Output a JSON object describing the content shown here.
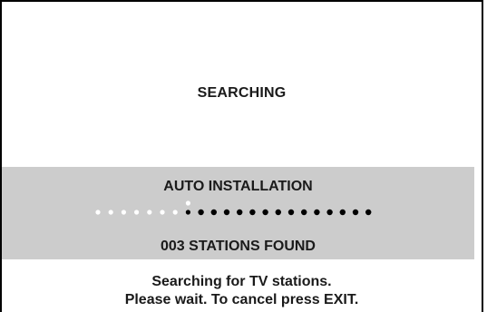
{
  "screen": {
    "status_title": "SEARCHING",
    "panel": {
      "title": "AUTO INSTALLATION",
      "stations_found": "003 STATIONS FOUND",
      "progress": {
        "total_dots": 22,
        "completed_dots": 8,
        "fraction": 0.36,
        "completed_color": "#ffffff",
        "remaining_color": "#000000"
      }
    },
    "message_line1": "Searching for TV stations.",
    "message_line2": "Please wait. To cancel press EXIT.",
    "colors": {
      "panel_bg": "#cccccc",
      "text": "#1a1a1a",
      "background": "#ffffff"
    }
  }
}
